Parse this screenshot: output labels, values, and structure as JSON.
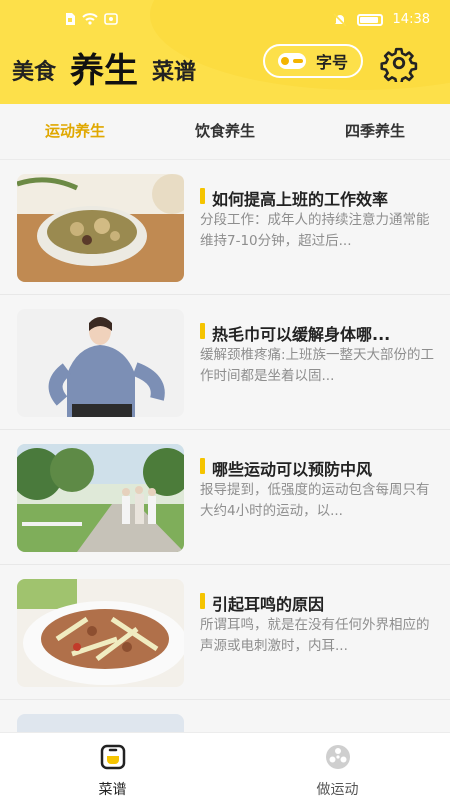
{
  "status_bar": {
    "time": "14:38"
  },
  "header": {
    "nav": [
      {
        "label": "美食"
      },
      {
        "label": "养生"
      },
      {
        "label": "菜谱"
      }
    ],
    "font_button_label": "字号"
  },
  "tabs": [
    {
      "label": "运动养生"
    },
    {
      "label": "饮食养生"
    },
    {
      "label": "四季养生"
    }
  ],
  "articles": [
    {
      "title": "如何提高上班的工作效率",
      "desc": "分段工作：成年人的持续注意力通常能维持7-10分钟，超过后..."
    },
    {
      "title": "热毛巾可以缓解身体哪...",
      "desc": "缓解颈椎疼痛:上班族一整天大部份的工作时间都是坐着以固..."
    },
    {
      "title": "哪些运动可以预防中风",
      "desc": "报导提到，低强度的运动包含每周只有大约4小时的运动，以..."
    },
    {
      "title": "引起耳鸣的原因",
      "desc": "所谓耳鸣，就是在没有任何外界相应的声源或电刺激时，内耳..."
    }
  ],
  "bottom_nav": [
    {
      "label": "菜谱",
      "icon": "recipe-pot-icon"
    },
    {
      "label": "做运动",
      "icon": "film-reel-icon"
    }
  ],
  "colors": {
    "header": "#fde04a",
    "accent": "#e0a800",
    "marker": "#f5c400"
  }
}
